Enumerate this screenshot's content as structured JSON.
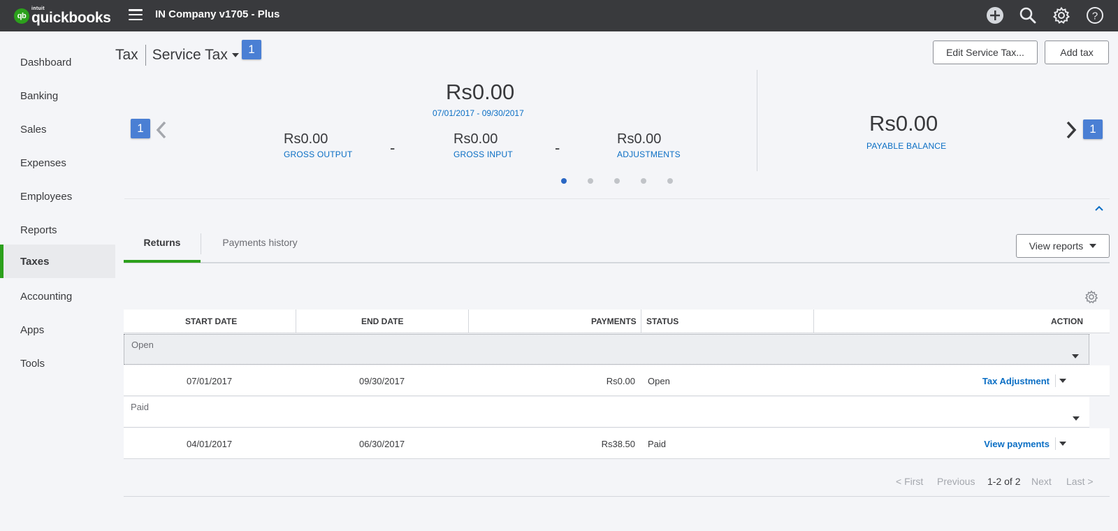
{
  "brand": {
    "intuit": "intuit",
    "name": "quickbooks",
    "short": "qb",
    "accent": "#2ca01c"
  },
  "topbar": {
    "company": "IN Company v1705 - Plus",
    "icons": [
      "plus-circle-icon",
      "search-icon",
      "gear-icon",
      "help-icon"
    ]
  },
  "sidebar": {
    "items": [
      {
        "label": "Dashboard"
      },
      {
        "label": "Banking"
      },
      {
        "label": "Sales"
      },
      {
        "label": "Expenses"
      },
      {
        "label": "Employees"
      },
      {
        "label": "Reports"
      },
      {
        "label": "Taxes",
        "active": true
      },
      {
        "label": "Accounting"
      },
      {
        "label": "Apps"
      },
      {
        "label": "Tools"
      }
    ]
  },
  "header": {
    "title": "Tax",
    "subtitle": "Service Tax",
    "badge": "1",
    "edit_button": "Edit Service Tax...",
    "add_button": "Add tax"
  },
  "summary": {
    "total": "Rs0.00",
    "period": "07/01/2017 - 09/30/2017",
    "prev_badge": "1",
    "next_badge": "1",
    "gross_output": {
      "amount": "Rs0.00",
      "label": "GROSS OUTPUT"
    },
    "minus1": "-",
    "gross_input": {
      "amount": "Rs0.00",
      "label": "GROSS INPUT"
    },
    "minus2": "-",
    "adjustments": {
      "amount": "Rs0.00",
      "label": "ADJUSTMENTS"
    },
    "payable": {
      "amount": "Rs0.00",
      "label": "PAYABLE BALANCE"
    },
    "pages": 5,
    "current_page": 1
  },
  "tabs": {
    "returns": "Returns",
    "payments_history": "Payments history",
    "view_reports": "View reports"
  },
  "table": {
    "headers": {
      "start": "START DATE",
      "end": "END DATE",
      "payments": "PAYMENTS",
      "status": "STATUS",
      "action": "ACTION"
    },
    "groups": [
      {
        "label": "Open",
        "rows": [
          {
            "start": "07/01/2017",
            "end": "09/30/2017",
            "payments": "Rs0.00",
            "status": "Open",
            "action": "Tax Adjustment"
          }
        ]
      },
      {
        "label": "Paid",
        "rows": [
          {
            "start": "04/01/2017",
            "end": "06/30/2017",
            "payments": "Rs38.50",
            "status": "Paid",
            "action": "View payments"
          }
        ]
      }
    ]
  },
  "pager": {
    "first": "< First",
    "previous": "Previous",
    "range": "1-2 of 2",
    "next": "Next",
    "last": "Last >"
  }
}
